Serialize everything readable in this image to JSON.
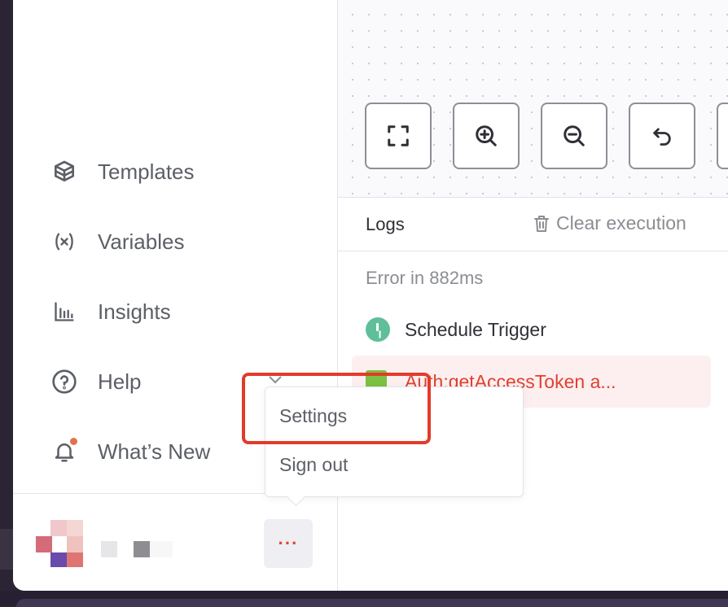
{
  "sidebar": {
    "items": [
      {
        "label": "Templates",
        "icon": "box-icon"
      },
      {
        "label": "Variables",
        "icon": "variable-icon"
      },
      {
        "label": "Insights",
        "icon": "bar-chart-icon"
      },
      {
        "label": "Help",
        "icon": "help-circle-icon"
      },
      {
        "label": "What’s New",
        "icon": "bell-icon"
      }
    ],
    "more_label": "···"
  },
  "user_menu": {
    "items": [
      {
        "label": "Settings"
      },
      {
        "label": "Sign out"
      }
    ]
  },
  "canvas_controls": [
    {
      "icon": "fit-view-icon"
    },
    {
      "icon": "zoom-in-icon"
    },
    {
      "icon": "zoom-out-icon"
    },
    {
      "icon": "undo-icon"
    }
  ],
  "logs": {
    "title": "Logs",
    "clear_label": "Clear execution",
    "status": "Error in 882ms",
    "entries": [
      {
        "label": "Schedule Trigger",
        "status": "success"
      },
      {
        "label": "Auth:getAccessToken a...",
        "status": "error"
      }
    ]
  },
  "colors": {
    "accent": "#e0462e",
    "error_text": "#e0412f",
    "error_bg": "#fdeff0",
    "success": "#5fbf9b",
    "highlight": "#e23b2b"
  }
}
